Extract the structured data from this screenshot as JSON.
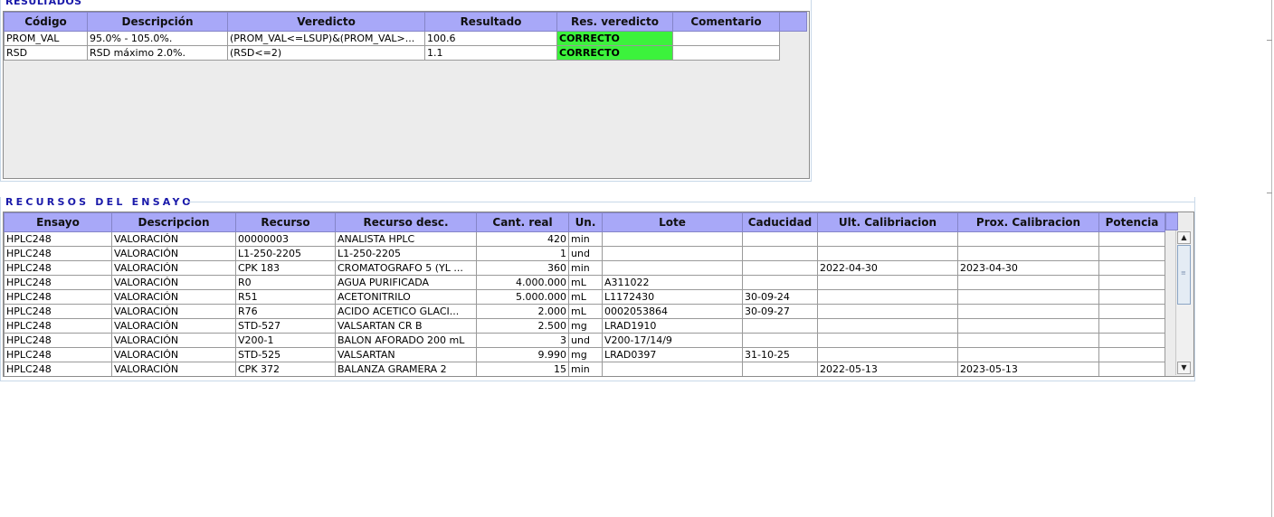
{
  "resultados": {
    "title": "RESULTADOS",
    "columns": [
      "Código",
      "Descripción",
      "Veredicto",
      "Resultado",
      "Res. veredicto",
      "Comentario"
    ],
    "rows": [
      [
        "PROM_VAL",
        "95.0% - 105.0%.",
        "(PROM_VAL<=LSUP)&(PROM_VAL>...",
        "100.6",
        "CORRECTO",
        ""
      ],
      [
        "RSD",
        "RSD máximo 2.0%.",
        "(RSD<=2)",
        "1.1",
        "CORRECTO",
        ""
      ]
    ],
    "verdict_color": "#3cf23c"
  },
  "recursos": {
    "title": "RECURSOS DEL ENSAYO",
    "columns": [
      "Ensayo",
      "Descripcion",
      "Recurso",
      "Recurso desc.",
      "Cant. real",
      "Un.",
      "Lote",
      "Caducidad",
      "Ult. Calibriacion",
      "Prox. Calibracion",
      "Potencia"
    ],
    "rows": [
      [
        "HPLC248",
        "VALORACIÓN",
        "00000003",
        "ANALISTA HPLC",
        "420",
        "min",
        "",
        "",
        "",
        "",
        ""
      ],
      [
        "HPLC248",
        "VALORACIÓN",
        "L1-250-2205",
        "L1-250-2205",
        "1",
        "und",
        "",
        "",
        "",
        "",
        ""
      ],
      [
        "HPLC248",
        "VALORACIÓN",
        "CPK 183",
        "CROMATOGRAFO 5 (YL ...",
        "360",
        "min",
        "",
        "",
        "2022-04-30",
        "2023-04-30",
        ""
      ],
      [
        "HPLC248",
        "VALORACIÓN",
        "R0",
        "AGUA PURIFICADA",
        "4.000.000",
        "mL",
        "A311022",
        "",
        "",
        "",
        ""
      ],
      [
        "HPLC248",
        "VALORACIÓN",
        "R51",
        "ACETONITRILO",
        "5.000.000",
        "mL",
        "L1172430",
        "30-09-24",
        "",
        "",
        ""
      ],
      [
        "HPLC248",
        "VALORACIÓN",
        "R76",
        "ACIDO ACETICO GLACI...",
        "2.000",
        "mL",
        "0002053864",
        "30-09-27",
        "",
        "",
        ""
      ],
      [
        "HPLC248",
        "VALORACIÓN",
        "STD-527",
        "VALSARTAN CR B",
        "2.500",
        "mg",
        "LRAD1910",
        "",
        "",
        "",
        ""
      ],
      [
        "HPLC248",
        "VALORACIÓN",
        "V200-1",
        "BALON AFORADO 200 mL",
        "3",
        "und",
        "V200-17/14/9",
        "",
        "",
        "",
        ""
      ],
      [
        "HPLC248",
        "VALORACIÓN",
        "STD-525",
        "VALSARTAN",
        "9.990",
        "mg",
        "LRAD0397",
        "31-10-25",
        "",
        "",
        ""
      ],
      [
        "HPLC248",
        "VALORACIÓN",
        "CPK 372",
        "BALANZA GRAMERA 2",
        "15",
        "min",
        "",
        "",
        "2022-05-13",
        "2023-05-13",
        ""
      ]
    ],
    "header_color": "#a8a8f8"
  },
  "scrollbar": {
    "up_icon": "▲",
    "down_icon": "▼",
    "grip_icon": "≡"
  }
}
